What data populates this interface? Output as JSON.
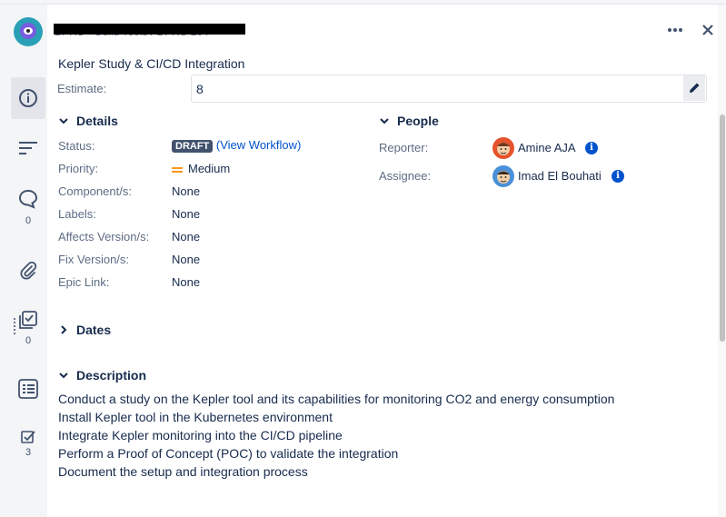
{
  "header": {
    "breadcrumb": "BPRS - Guild Tools / DPRS-204",
    "more_icon": "more-horizontal-icon",
    "close_icon": "close-icon"
  },
  "sidebar": {
    "items": [
      {
        "icon": "info-icon"
      },
      {
        "icon": "history-lines-icon"
      },
      {
        "icon": "comment-icon",
        "count": "0"
      },
      {
        "icon": "attachment-icon"
      },
      {
        "icon": "checklist-icon",
        "count": "0"
      },
      {
        "icon": "subtasks-icon"
      },
      {
        "icon": "checkbox-icon",
        "count": "3"
      }
    ]
  },
  "issue": {
    "summary": "Kepler Study & CI/CD Integration",
    "estimate_label": "Estimate:",
    "estimate_value": "8"
  },
  "details": {
    "heading": "Details",
    "status_label": "Status:",
    "status_badge": "DRAFT",
    "view_workflow": "(View Workflow)",
    "priority_label": "Priority:",
    "priority_value": "Medium",
    "component_label": "Component/s:",
    "component_value": "None",
    "labels_label": "Labels:",
    "labels_value": "None",
    "affects_label": "Affects Version/s:",
    "affects_value": "None",
    "fix_label": "Fix Version/s:",
    "fix_value": "None",
    "epic_label": "Epic Link:",
    "epic_value": "None"
  },
  "people": {
    "heading": "People",
    "reporter_label": "Reporter:",
    "reporter_name": "Amine AJA",
    "assignee_label": "Assignee:",
    "assignee_name": "Imad El Bouhati"
  },
  "dates": {
    "heading": "Dates"
  },
  "description": {
    "heading": "Description",
    "lines": [
      "Conduct a study on the Kepler tool and its capabilities for monitoring CO2 and energy consumption",
      "Install Kepler tool in the Kubernetes environment",
      "Integrate Kepler monitoring into the CI/CD pipeline",
      "Perform a Proof of Concept (POC) to validate the integration",
      "Document the setup and integration process"
    ]
  },
  "colors": {
    "link": "#0052cc",
    "draft_badge": "#42526e",
    "priority_medium": "#ff991f"
  }
}
